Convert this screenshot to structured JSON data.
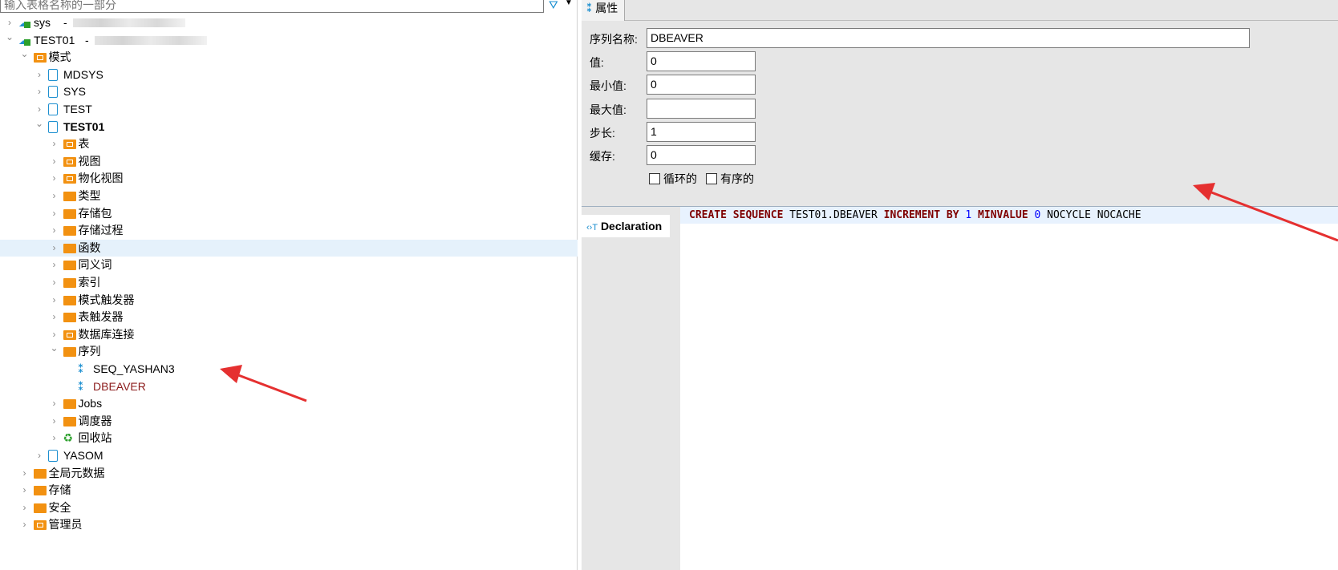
{
  "navigator": {
    "filter_placeholder": "输入表格名称的一部分",
    "tree": [
      {
        "label": "sys",
        "suffix": "-",
        "level": 0,
        "icon": "connection-icon",
        "expanded": false
      },
      {
        "label": "TEST01",
        "suffix": "-",
        "level": 0,
        "icon": "connection-icon",
        "expanded": true
      },
      {
        "label": "模式",
        "level": 1,
        "icon": "schemas-folder-icon",
        "expanded": true
      },
      {
        "label": "MDSYS",
        "level": 2,
        "icon": "schema-icon",
        "expanded": false
      },
      {
        "label": "SYS",
        "level": 2,
        "icon": "schema-icon",
        "expanded": false
      },
      {
        "label": "TEST",
        "level": 2,
        "icon": "schema-icon",
        "expanded": false
      },
      {
        "label": "TEST01",
        "level": 2,
        "icon": "schema-icon",
        "expanded": true,
        "bold": true
      },
      {
        "label": "表",
        "level": 3,
        "icon": "table-folder-icon",
        "expanded": false
      },
      {
        "label": "视图",
        "level": 3,
        "icon": "view-folder-icon",
        "expanded": false
      },
      {
        "label": "物化视图",
        "level": 3,
        "icon": "view-folder-icon",
        "expanded": false
      },
      {
        "label": "类型",
        "level": 3,
        "icon": "folder-icon",
        "expanded": false
      },
      {
        "label": "存储包",
        "level": 3,
        "icon": "folder-icon",
        "expanded": false
      },
      {
        "label": "存储过程",
        "level": 3,
        "icon": "folder-icon",
        "expanded": false
      },
      {
        "label": "函数",
        "level": 3,
        "icon": "folder-icon",
        "expanded": false,
        "selected": true
      },
      {
        "label": "同义词",
        "level": 3,
        "icon": "folder-icon",
        "expanded": false
      },
      {
        "label": "索引",
        "level": 3,
        "icon": "folder-icon",
        "expanded": false
      },
      {
        "label": "模式触发器",
        "level": 3,
        "icon": "folder-icon",
        "expanded": false
      },
      {
        "label": "表触发器",
        "level": 3,
        "icon": "folder-icon",
        "expanded": false
      },
      {
        "label": "数据库连接",
        "level": 3,
        "icon": "link-folder-icon",
        "expanded": false
      },
      {
        "label": "序列",
        "level": 3,
        "icon": "folder-icon",
        "expanded": true
      },
      {
        "label": "SEQ_YASHAN3",
        "level": 4,
        "icon": "sequence-icon"
      },
      {
        "label": "DBEAVER",
        "level": 4,
        "icon": "sequence-icon",
        "color": "#8b1a1a"
      },
      {
        "label": "Jobs",
        "level": 3,
        "icon": "folder-icon",
        "expanded": false
      },
      {
        "label": "调度器",
        "level": 3,
        "icon": "folder-icon",
        "expanded": false
      },
      {
        "label": "回收站",
        "level": 3,
        "icon": "recycle-icon",
        "expanded": false
      },
      {
        "label": "YASOM",
        "level": 2,
        "icon": "schema-icon",
        "expanded": false
      },
      {
        "label": "全局元数据",
        "level": 1,
        "icon": "folder-icon",
        "expanded": false
      },
      {
        "label": "存储",
        "level": 1,
        "icon": "folder-icon",
        "expanded": false
      },
      {
        "label": "安全",
        "level": 1,
        "icon": "folder-icon",
        "expanded": false
      },
      {
        "label": "管理员",
        "level": 1,
        "icon": "admin-folder-icon",
        "expanded": false
      }
    ]
  },
  "properties": {
    "tab_label": "属性",
    "fields": [
      {
        "label": "序列名称:",
        "value": "DBEAVER"
      },
      {
        "label": "值:",
        "value": "0"
      },
      {
        "label": "最小值:",
        "value": "0"
      },
      {
        "label": "最大值:",
        "value": ""
      },
      {
        "label": "步长:",
        "value": "1"
      },
      {
        "label": "缓存:",
        "value": "0"
      }
    ],
    "cycle_label": "循环的",
    "cycle_checked": false,
    "ordered_label": "有序的",
    "ordered_checked": false
  },
  "declaration": {
    "tab_label": "Declaration",
    "tokens": [
      {
        "t": "CREATE SEQUENCE",
        "c": "kw"
      },
      {
        "t": " TEST01.DBEAVER ",
        "c": ""
      },
      {
        "t": "INCREMENT BY",
        "c": "kw"
      },
      {
        "t": " 1 ",
        "c": "num"
      },
      {
        "t": "MINVALUE",
        "c": "kw"
      },
      {
        "t": " 0 ",
        "c": "num"
      },
      {
        "t": "NOCYCLE NOCACHE",
        "c": ""
      }
    ]
  },
  "colors": {
    "accent": "#1e90d0",
    "folder": "#f29111",
    "selection": "#e5f1fb",
    "annotation_arrow": "#e53030"
  }
}
